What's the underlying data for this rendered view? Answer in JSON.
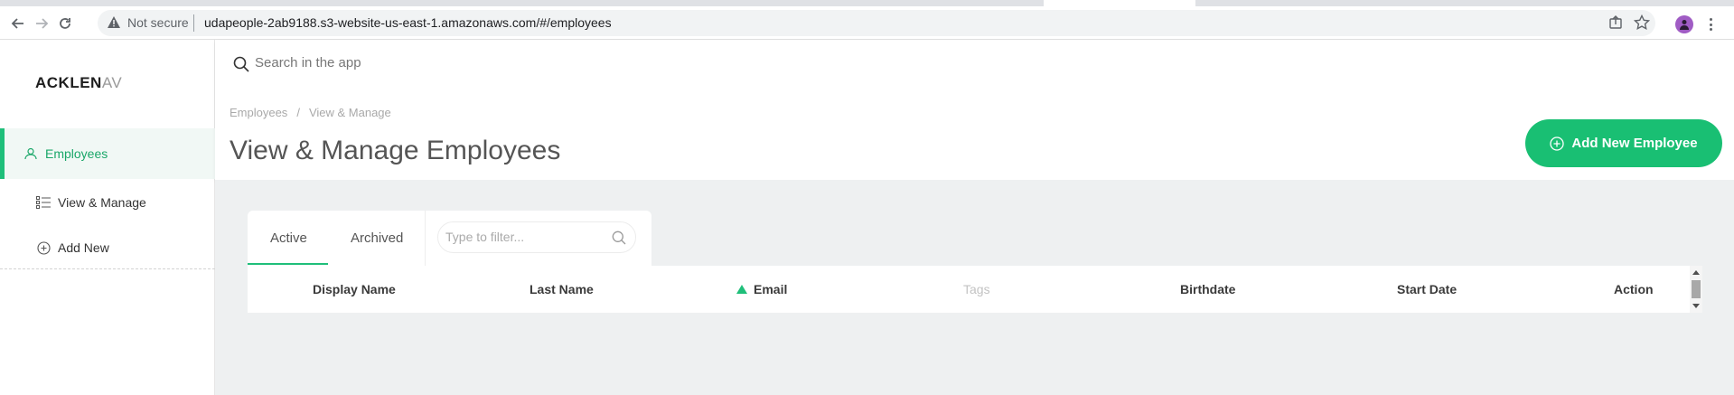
{
  "browser": {
    "security_label": "Not secure",
    "url": "udapeople-2ab9188.s3-website-us-east-1.amazonaws.com/#/employees"
  },
  "sidebar": {
    "logo_strong": "ACKLEN",
    "logo_faded": "AV",
    "items": [
      {
        "label": "Employees",
        "icon": "user-icon",
        "active": true
      },
      {
        "label": "View & Manage",
        "icon": "list-icon",
        "active": false
      },
      {
        "label": "Add New",
        "icon": "plus-circle-icon",
        "active": false
      }
    ]
  },
  "header": {
    "search_placeholder": "Search in the app",
    "breadcrumb": [
      "Employees",
      "View & Manage"
    ],
    "breadcrumb_separator": "/",
    "title": "View & Manage Employees",
    "add_button_label": "Add New Employee"
  },
  "tabs": {
    "items": [
      {
        "label": "Active",
        "active": true
      },
      {
        "label": "Archived",
        "active": false
      }
    ],
    "filter_placeholder": "Type to filter..."
  },
  "table": {
    "columns": [
      "Display Name",
      "Last Name",
      "Email",
      "Tags",
      "Birthdate",
      "Start Date",
      "Action"
    ],
    "sorted_column": "Email",
    "sort_direction": "ascending"
  },
  "colors": {
    "accent": "#19bf73",
    "content_bg": "#eef0f1"
  }
}
